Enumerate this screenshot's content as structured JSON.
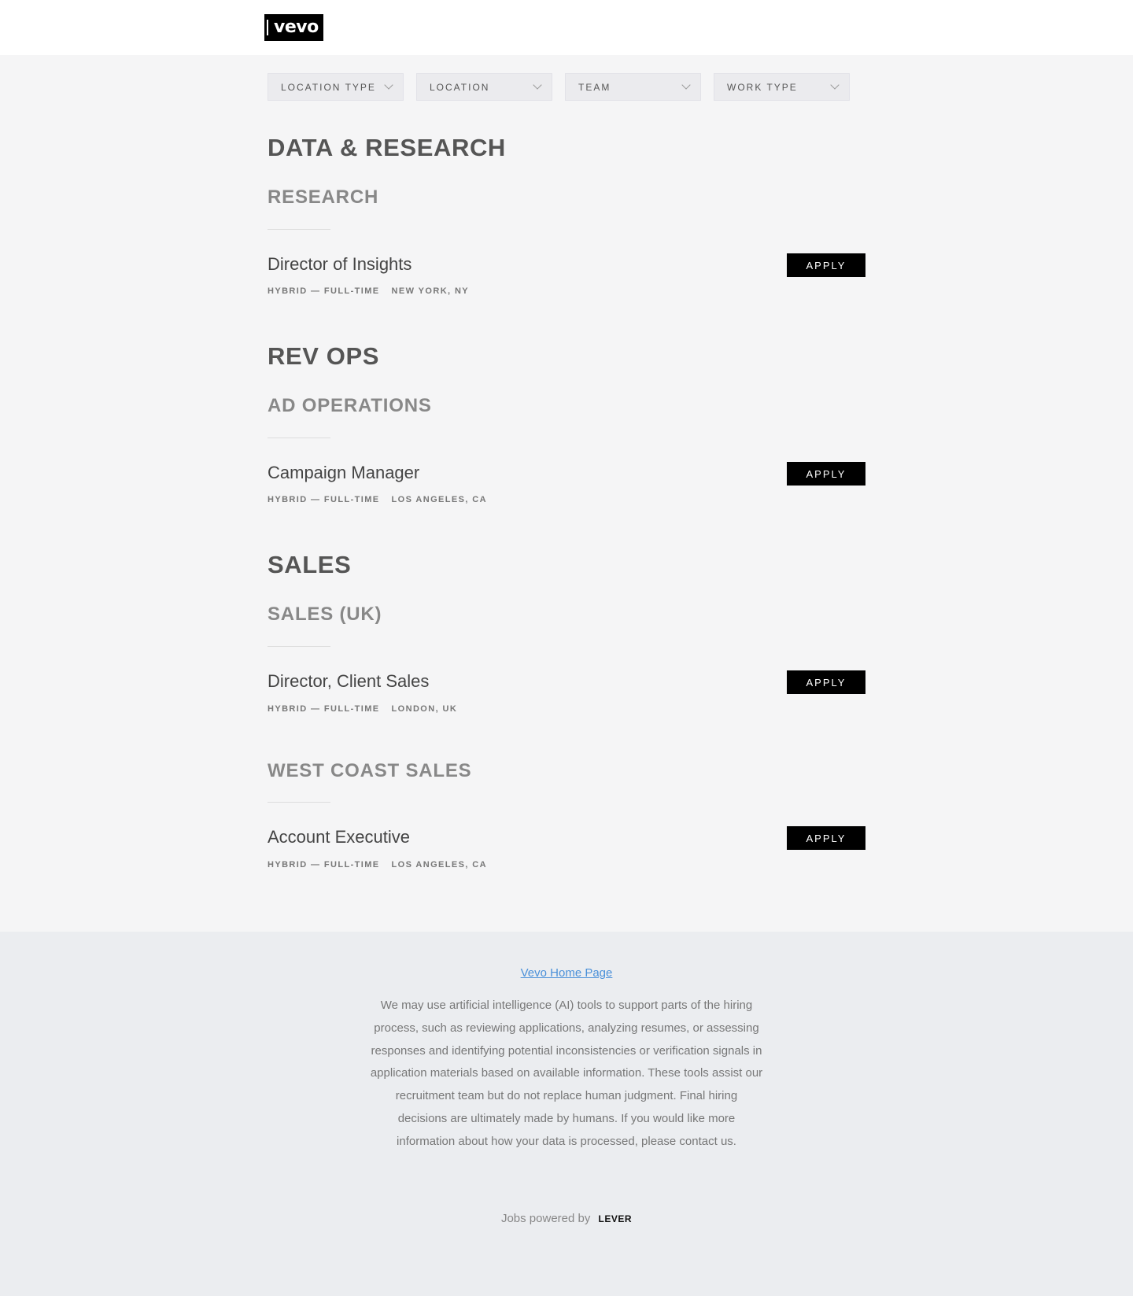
{
  "header": {
    "logo_text": "vevo"
  },
  "filters": [
    {
      "label": "LOCATION TYPE"
    },
    {
      "label": "LOCATION"
    },
    {
      "label": "TEAM"
    },
    {
      "label": "WORK TYPE"
    }
  ],
  "groups": [
    {
      "title": "DATA & RESEARCH",
      "subs": [
        {
          "title": "RESEARCH",
          "jobs": [
            {
              "title": "Director of Insights",
              "workplace": "HYBRID — FULL-TIME",
              "location": "NEW YORK, NY",
              "apply": "APPLY"
            }
          ]
        }
      ]
    },
    {
      "title": "REV OPS",
      "subs": [
        {
          "title": "AD OPERATIONS",
          "jobs": [
            {
              "title": "Campaign Manager",
              "workplace": "HYBRID — FULL-TIME",
              "location": "LOS ANGELES, CA",
              "apply": "APPLY"
            }
          ]
        }
      ]
    },
    {
      "title": "SALES",
      "subs": [
        {
          "title": "SALES (UK)",
          "jobs": [
            {
              "title": "Director, Client Sales",
              "workplace": "HYBRID — FULL-TIME",
              "location": "LONDON, UK",
              "apply": "APPLY"
            }
          ]
        },
        {
          "title": "WEST COAST SALES",
          "jobs": [
            {
              "title": "Account Executive",
              "workplace": "HYBRID — FULL-TIME",
              "location": "LOS ANGELES, CA",
              "apply": "APPLY"
            }
          ]
        }
      ]
    }
  ],
  "footer": {
    "home_link": "Vevo Home Page",
    "disclaimer": "We may use artificial intelligence (AI) tools to support parts of the hiring process, such as reviewing applications, analyzing resumes, or assessing responses and identifying potential inconsistencies or verification signals in application materials based on available information. These tools assist our recruitment team but do not replace human judgment. Final hiring decisions are ultimately made by humans. If you would like more information about how your data is processed, please contact us.",
    "powered_by": "Jobs powered by",
    "powered_brand": "LEVER"
  }
}
